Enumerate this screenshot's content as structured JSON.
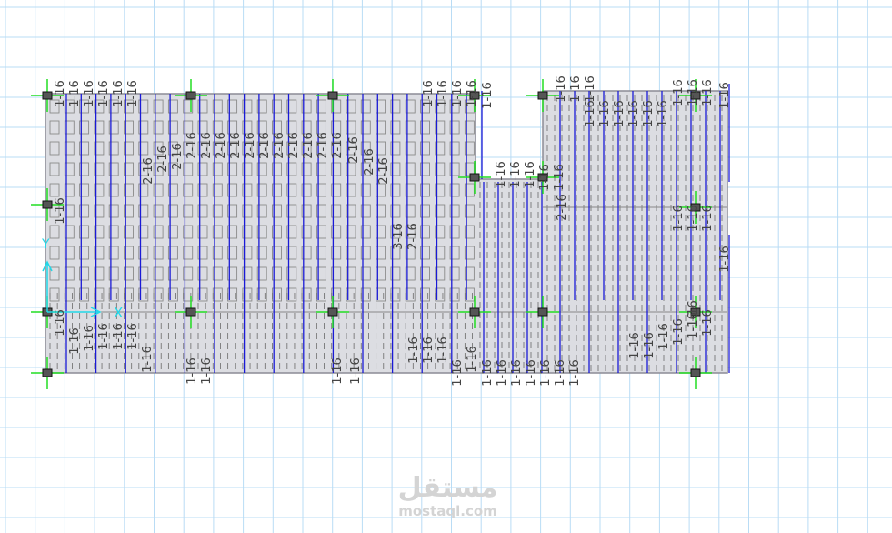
{
  "drawing": {
    "colors": {
      "grid": "#b9dcf5",
      "slab": "#dcdde2",
      "slab_edge": "#8c8c96",
      "rebar": "#1a1ad6",
      "column_marker": "#22dd22",
      "axis": "#22d8e8",
      "label": "#444444"
    },
    "axis_labels": {
      "x": "X",
      "y": "Y"
    },
    "rebar_labels": [
      "1-16",
      "1-16",
      "1-16",
      "1-16",
      "1-16",
      "1-16",
      "2-16",
      "2-16",
      "2-16",
      "2-16",
      "2-16",
      "2-16",
      "2-16",
      "2-16",
      "2-16",
      "2-16",
      "2-16",
      "2-16",
      "2-16",
      "2-16",
      "2-16",
      "2-16",
      "2-16",
      "3-16",
      "2-16",
      "2-16",
      "1-16",
      "1-16",
      "1-16",
      "1-16",
      "1-16",
      "1-16",
      "1-16",
      "1-16",
      "1-16",
      "1-16",
      "1-16",
      "1-16",
      "1-16",
      "1-16",
      "1-16",
      "1-16",
      "1-16",
      "1-16",
      "1-16",
      "1-16",
      "1-16",
      "1-16",
      "1-16",
      "1-16",
      "1-16",
      "1-16",
      "1-16",
      "1-16",
      "1-16",
      "1-16",
      "1-16",
      "1-16",
      "1-16",
      "1-16",
      "1-16",
      "1-16",
      "1-16",
      "1-16",
      "1-16",
      "1-16",
      "1-16",
      "1-16",
      "1-16",
      "1-16",
      "1-16",
      "1-16",
      "1-16",
      "1-16",
      "1-16",
      "1-16",
      "1-16",
      "1-16",
      "1-16",
      "1-16",
      "1-16",
      "1-16",
      "1-16",
      "1-16"
    ]
  },
  "watermark": {
    "arabic": "مستقل",
    "latin": "mostaql.com"
  }
}
